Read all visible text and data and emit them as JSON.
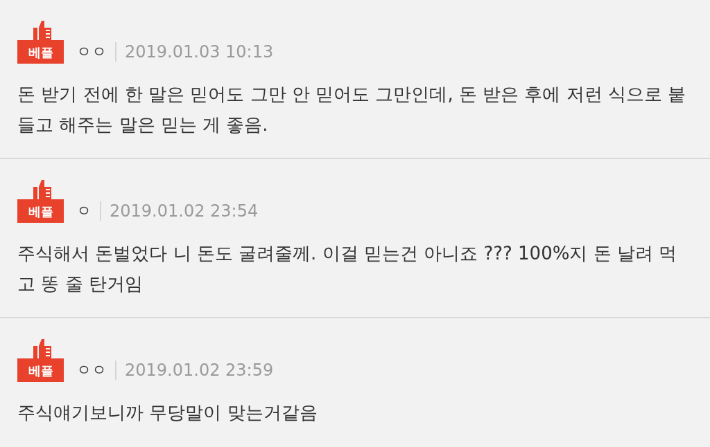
{
  "comments": [
    {
      "badge": "베플",
      "author": "ㅇㅇ",
      "date": "2019.01.03 10:13",
      "text": "돈 받기 전에 한 말은 믿어도 그만 안 믿어도 그만인데, 돈 받은 후에 저런 식으로 붙들고 해주는 말은 믿는 게 좋음."
    },
    {
      "badge": "베플",
      "author": "ㅇ",
      "date": "2019.01.02 23:54",
      "text": "주식해서 돈벌었다 니 돈도 굴려줄께. 이걸 믿는건 아니죠 ??? 100%지 돈 날려 먹고 똥 줄 탄거임"
    },
    {
      "badge": "베플",
      "author": "ㅇㅇ",
      "date": "2019.01.02 23:59",
      "text": "주식얘기보니까 무당말이 맞는거같음"
    }
  ]
}
